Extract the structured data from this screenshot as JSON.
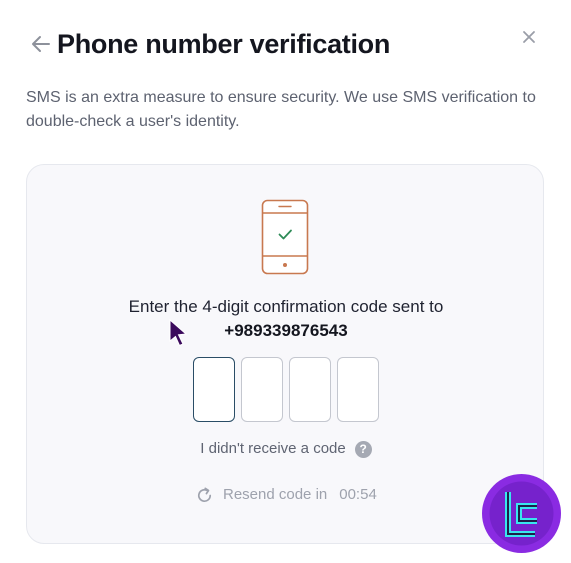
{
  "dialog": {
    "title": "Phone number verification",
    "description": "SMS is an extra measure to ensure security. We use SMS verification to double-check a user's identity."
  },
  "verification": {
    "instruction": "Enter the 4-digit confirmation code sent to",
    "phone_number": "+989339876543",
    "code_digits": [
      "",
      "",
      "",
      ""
    ],
    "no_code_label": "I didn't receive a code",
    "help_glyph": "?",
    "resend_label": "Resend code in",
    "resend_timer": "00:54"
  },
  "icons": {
    "back": "arrow-left-icon",
    "close": "close-icon",
    "phone": "phone-check-icon",
    "help": "question-icon",
    "resend": "refresh-icon",
    "logo": "tc-logo-icon"
  },
  "colors": {
    "accent_outline": "#c8784f",
    "check": "#2e8b57",
    "active_input_border": "#2a4d66",
    "logo_purple": "#8a2be2",
    "logo_cyan": "#39e6ee"
  }
}
